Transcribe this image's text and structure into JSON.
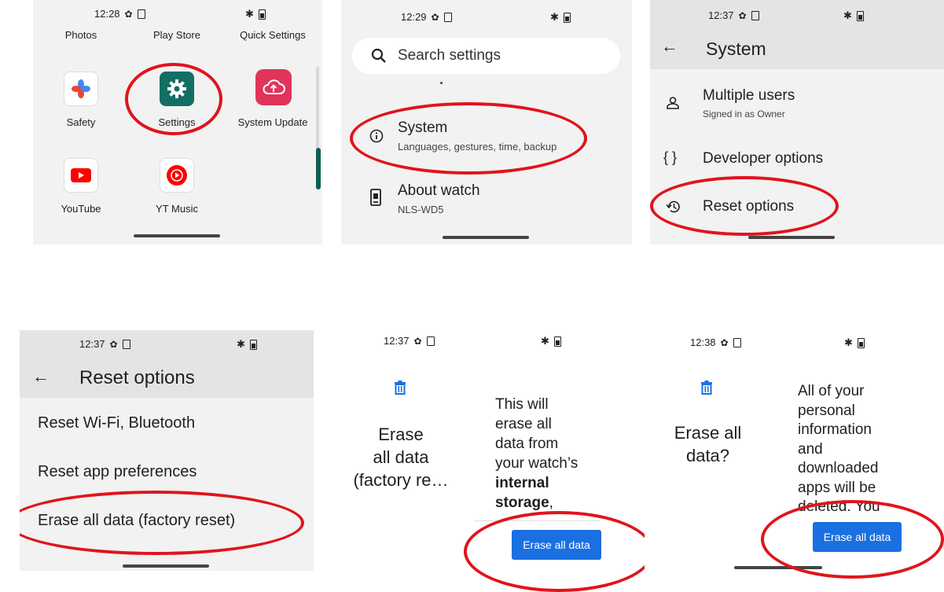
{
  "panel1": {
    "time": "12:28",
    "top_labels": [
      "Photos",
      "Play Store",
      "Quick Settings"
    ],
    "apps": [
      {
        "label": "Safety",
        "icon": "safety-icon"
      },
      {
        "label": "Settings",
        "icon": "gear-icon"
      },
      {
        "label": "System Update",
        "icon": "cloud-upload-icon"
      },
      {
        "label": "YouTube",
        "icon": "youtube-icon"
      },
      {
        "label": "YT Music",
        "icon": "yt-music-icon"
      }
    ]
  },
  "panel2": {
    "time": "12:29",
    "search_placeholder": "Search settings",
    "items": [
      {
        "title": "System",
        "subtitle": "Languages, gestures, time, backup",
        "icon": "info-icon"
      },
      {
        "title": "About watch",
        "subtitle": "NLS-WD5",
        "icon": "watch-icon"
      }
    ]
  },
  "panel3": {
    "time": "12:37",
    "title": "System",
    "items": [
      {
        "title": "Multiple users",
        "subtitle": "Signed in as Owner",
        "icon": "person-icon"
      },
      {
        "title": "Developer options",
        "icon": "braces-icon"
      },
      {
        "title": "Reset options",
        "icon": "history-icon"
      }
    ]
  },
  "panel4": {
    "time": "12:37",
    "title": "Reset options",
    "items": [
      "Reset Wi-Fi, Bluetooth",
      "Reset app preferences",
      "Erase all data (factory reset)"
    ]
  },
  "panel5": {
    "time": "12:37",
    "heading_lines": [
      "Erase",
      "all data",
      "(factory re…"
    ],
    "body_lines": [
      "This will",
      "erase all",
      "data from",
      "your watch’s"
    ],
    "bold_lines": [
      "internal",
      "storage"
    ],
    "bold_suffix": ",",
    "button": "Erase all data"
  },
  "panel6": {
    "time": "12:38",
    "heading_lines": [
      "Erase all",
      "data?"
    ],
    "body_lines": [
      "All of your",
      "personal",
      "information",
      "and",
      "downloaded",
      "apps will be",
      "deleted. You"
    ],
    "button": "Erase all data"
  },
  "colors": {
    "accent": "#1a6fe1",
    "highlight_ring": "#e0141c"
  }
}
